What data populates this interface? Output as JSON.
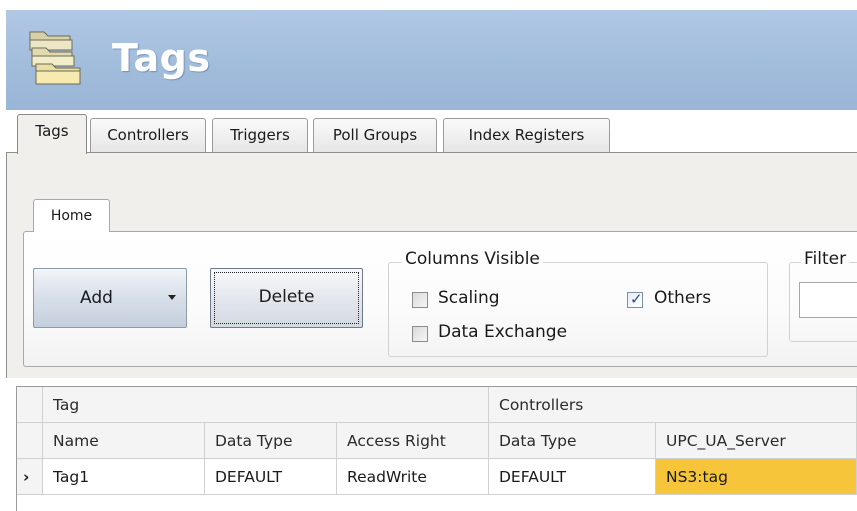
{
  "header": {
    "title": "Tags",
    "icon": "stacked-folders-icon"
  },
  "tabs": [
    {
      "label": "Tags",
      "active": true
    },
    {
      "label": "Controllers",
      "active": false
    },
    {
      "label": "Triggers",
      "active": false
    },
    {
      "label": "Poll Groups",
      "active": false
    },
    {
      "label": "Index Registers",
      "active": false
    }
  ],
  "ribbon": {
    "tab_label": "Home",
    "add_label": "Add",
    "delete_label": "Delete",
    "columns_visible": {
      "title": "Columns Visible",
      "scaling": {
        "label": "Scaling",
        "checked": false
      },
      "others": {
        "label": "Others",
        "checked": true
      },
      "data_exchange": {
        "label": "Data Exchange",
        "checked": false
      }
    },
    "filter": {
      "title": "Filter",
      "value": ""
    }
  },
  "grid": {
    "group_headers": [
      "Tag",
      "Controllers"
    ],
    "columns": [
      "Name",
      "Data Type",
      "Access Right",
      "Data Type",
      "UPC_UA_Server"
    ],
    "rows": [
      {
        "indicator": "›",
        "cells": [
          "Tag1",
          "DEFAULT",
          "ReadWrite",
          "DEFAULT",
          "NS3:tag"
        ]
      }
    ]
  },
  "colors": {
    "header_bg": "#a3bddc",
    "selection": "#f7c53a"
  }
}
